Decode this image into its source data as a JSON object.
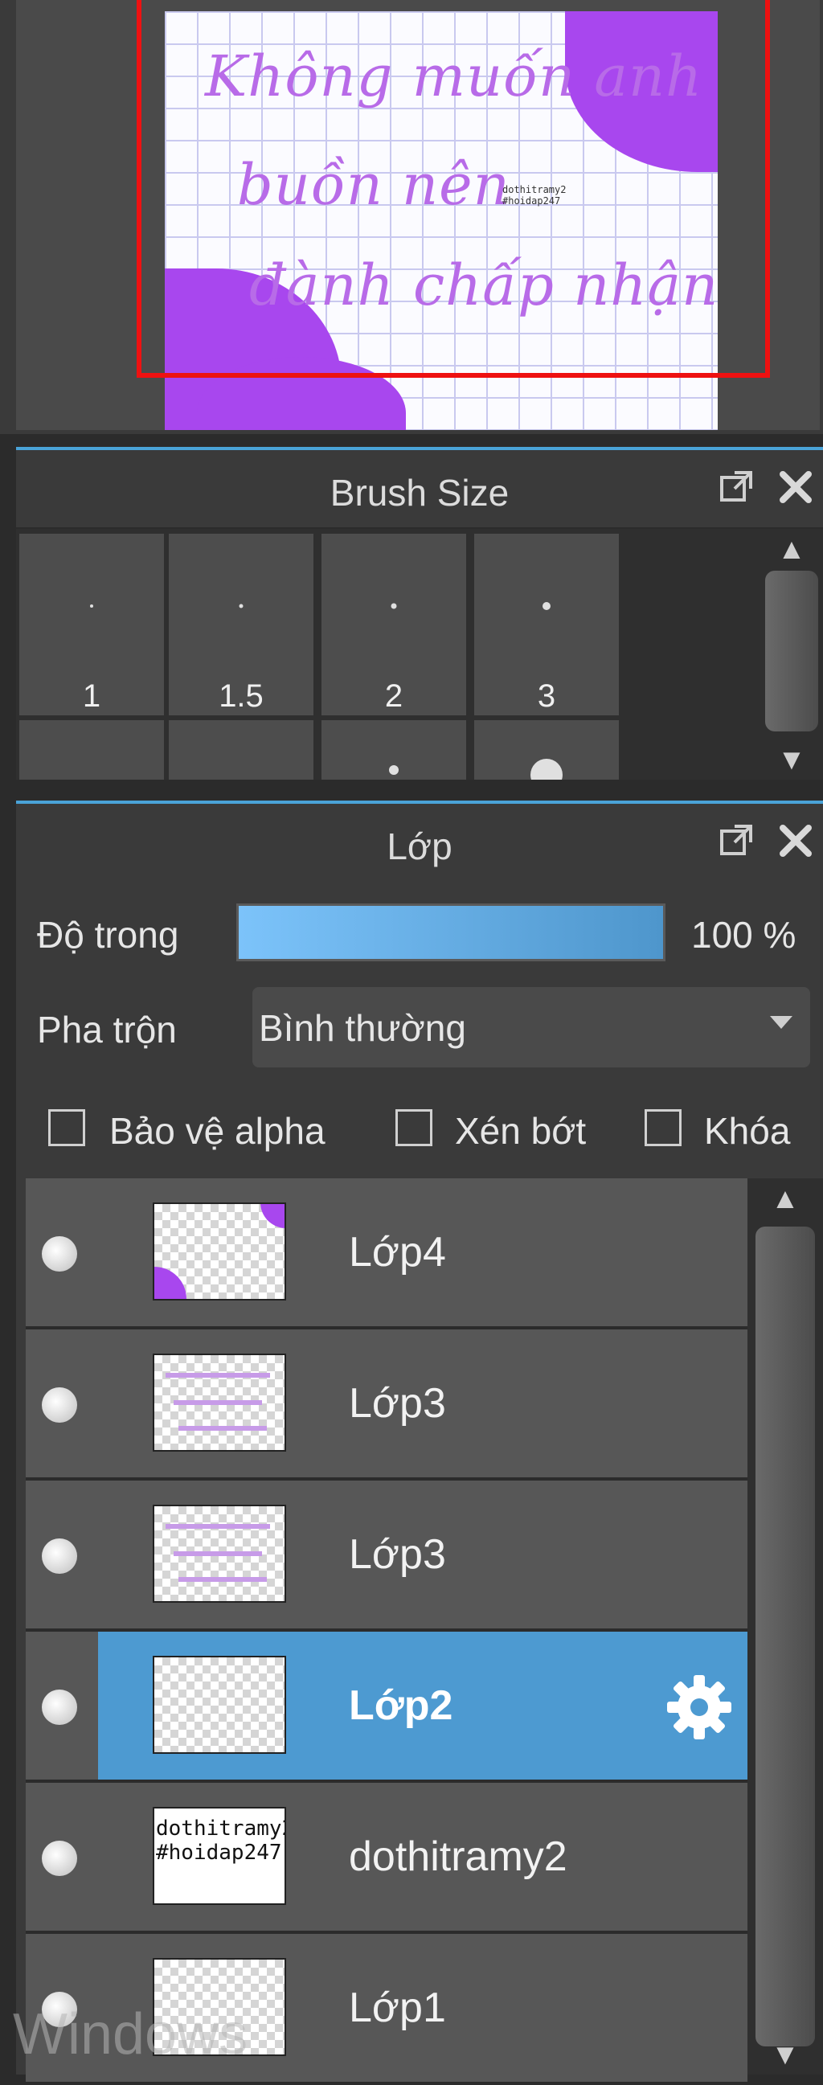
{
  "navigator": {
    "canvas_lines": [
      "Không muốn anh",
      "buồn nên",
      "đành chấp nhận"
    ],
    "stamp_text": [
      "dothitramy2",
      "#hoidap247"
    ],
    "colors": {
      "accent_purple": "#a847ee",
      "view_rect": "#ee1111"
    }
  },
  "brush_panel": {
    "title": "Brush Size",
    "sizes": [
      "1",
      "1.5",
      "2",
      "3"
    ],
    "popout_icon": "popout-icon",
    "close_icon": "close-icon"
  },
  "layer_panel": {
    "title": "Lớp",
    "opacity_label": "Độ trong",
    "opacity_value": "100 %",
    "opacity_fraction": 1.0,
    "blend_label": "Pha trộn",
    "blend_value": "Bình thường",
    "checkboxes": {
      "alpha": "Bảo vệ alpha",
      "clip": "Xén bớt",
      "lock": "Khóa"
    },
    "layers": [
      {
        "name": "Lớp4",
        "selected": false
      },
      {
        "name": "Lớp3",
        "selected": false
      },
      {
        "name": "Lớp3",
        "selected": false
      },
      {
        "name": "Lớp2",
        "selected": true
      },
      {
        "name": "dothitramy2",
        "selected": false,
        "thumb_text": [
          "dothitramy2",
          "#hoidap247"
        ]
      },
      {
        "name": "Lớp1",
        "selected": false
      }
    ],
    "selected_color": "#4d9ad1"
  },
  "watermark": "Windows"
}
